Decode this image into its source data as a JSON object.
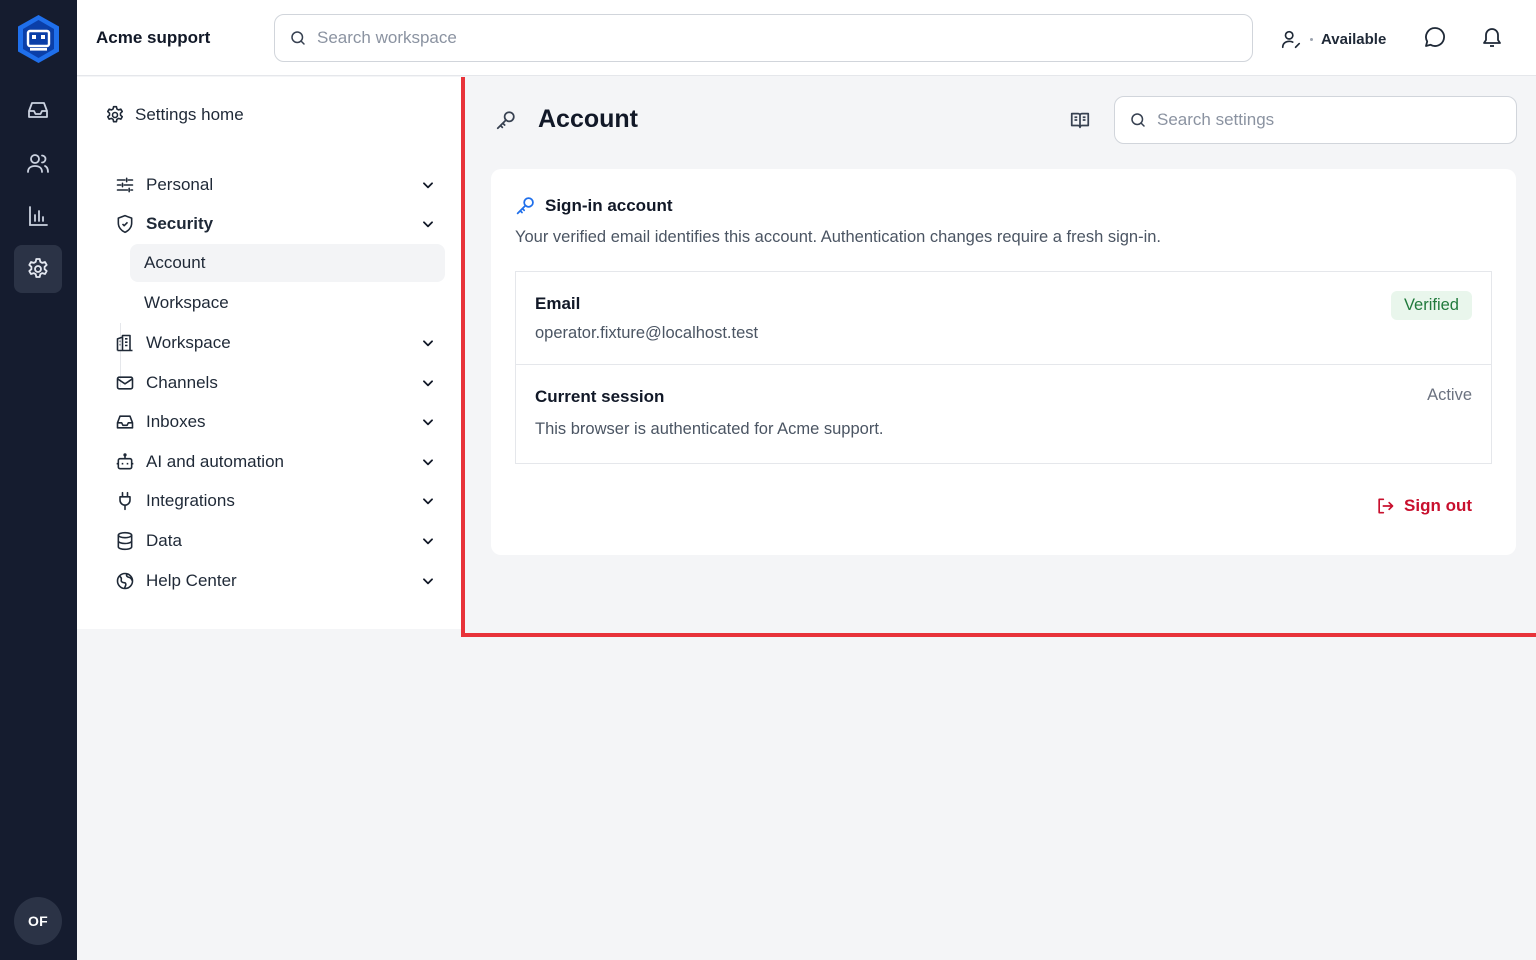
{
  "rail": {
    "logo": "app-logo",
    "items": [
      {
        "name": "inbox",
        "icon": "inbox-icon"
      },
      {
        "name": "contacts",
        "icon": "users-icon"
      },
      {
        "name": "reports",
        "icon": "bar-chart-icon"
      },
      {
        "name": "settings",
        "icon": "gear-icon",
        "active": true
      }
    ],
    "avatar_initials": "OF"
  },
  "topbar": {
    "workspace_name": "Acme support",
    "search_placeholder": "Search workspace",
    "availability": "Available"
  },
  "settings_nav": {
    "home_label": "Settings home",
    "items": [
      {
        "label": "Personal",
        "icon": "sliders-icon"
      },
      {
        "label": "Security",
        "icon": "shield-icon",
        "expanded": true
      },
      {
        "label": "Workspace",
        "icon": "building-icon"
      },
      {
        "label": "Channels",
        "icon": "mail-icon"
      },
      {
        "label": "Inboxes",
        "icon": "inbox-icon"
      },
      {
        "label": "AI and automation",
        "icon": "bot-icon"
      },
      {
        "label": "Integrations",
        "icon": "plug-icon"
      },
      {
        "label": "Data",
        "icon": "database-icon"
      },
      {
        "label": "Help Center",
        "icon": "globe-icon"
      }
    ],
    "security_sub": [
      {
        "label": "Account",
        "active": true
      },
      {
        "label": "Workspace"
      }
    ]
  },
  "content": {
    "title": "Account",
    "search_placeholder": "Search settings",
    "card": {
      "title": "Sign-in account",
      "description": "Your verified email identifies this account. Authentication changes require a fresh sign-in.",
      "email_label": "Email",
      "email_value": "operator.fixture@localhost.test",
      "email_badge": "Verified",
      "session_label": "Current session",
      "session_value": "This browser is authenticated for Acme support.",
      "session_status": "Active",
      "signout_label": "Sign out"
    }
  },
  "colors": {
    "rail_bg": "#151c2f",
    "accent_blue": "#1f6feb",
    "danger": "#c8102e",
    "success": "#217a3c",
    "highlight_border": "#e8333a"
  }
}
